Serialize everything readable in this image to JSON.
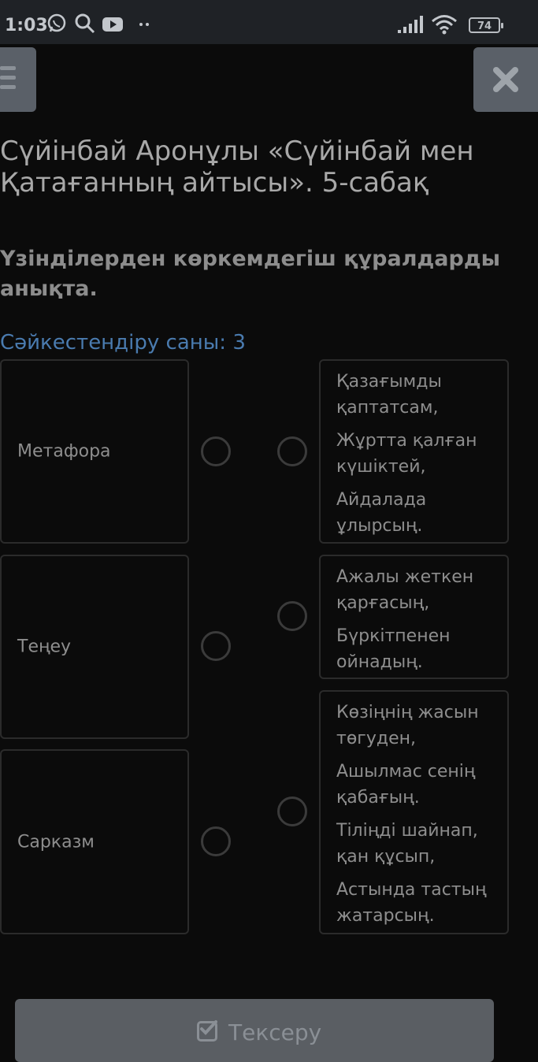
{
  "status_bar": {
    "time": "1:03",
    "battery": "74",
    "icons": [
      "whatsapp-icon",
      "search-icon",
      "youtube-icon",
      "more-dots-icon",
      "signal-icon",
      "wifi-icon",
      "battery-icon"
    ]
  },
  "header": {
    "menu_icon": "hamburger-icon",
    "close_icon": "close-icon"
  },
  "lesson": {
    "title": "Сүйінбай Аронұлы «Сүйінбай мен Қатағанның айтысы». 5-сабақ",
    "instruction": "Үзінділерден көркемдегіш құралдарды анықта.",
    "match_count": "Сәйкестендіру саны: 3"
  },
  "left_items": [
    {
      "label": "Метафора"
    },
    {
      "label": "Теңеу"
    },
    {
      "label": "Сарказм"
    }
  ],
  "right_items": [
    {
      "lines": [
        "Қазағымды қаптатсам,",
        "Жұртта қалған күшіктей,",
        "Айдалада ұлырсың."
      ]
    },
    {
      "lines": [
        "Ажалы жеткен қарғасың,",
        "Бүркітпенен ойнадың."
      ]
    },
    {
      "lines": [
        "Көзіңнің жасын төгуден,",
        "Ашылмас сенің қабағың.",
        "Тіліңді шайнап, қан құсып,",
        "Астында тастың жатарсың."
      ]
    }
  ],
  "actions": {
    "check_label": "Тексеру",
    "check_icon": "checkbox-check-icon"
  },
  "colors": {
    "background": "#0b0b0b",
    "accent": "#4a7baf",
    "button": "#5a5e63"
  }
}
